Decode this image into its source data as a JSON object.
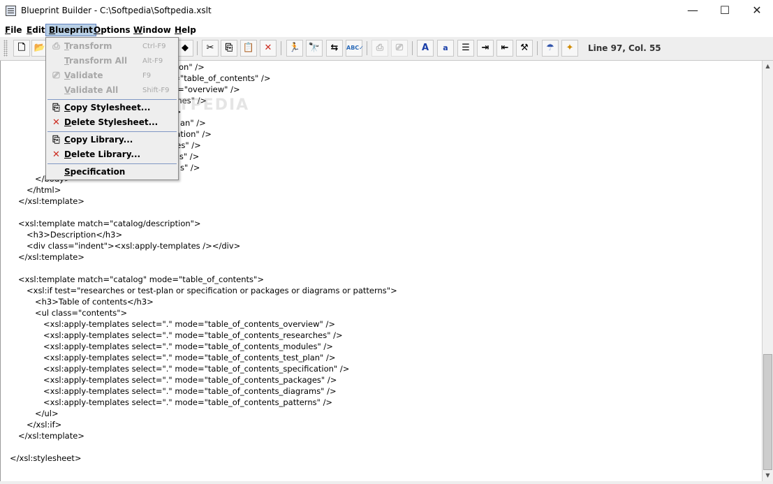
{
  "window": {
    "title": "Blueprint Builder - C:\\Softpedia\\Softpedia.xslt",
    "minimize_glyph": "—",
    "maximize_glyph": "☐",
    "close_glyph": "✕"
  },
  "menubar": {
    "items": [
      {
        "label": "File",
        "mnemonic": "F",
        "rest": "ile"
      },
      {
        "label": "Edit",
        "mnemonic": "E",
        "rest": "dit"
      },
      {
        "label": "Blueprint",
        "mnemonic": "B",
        "rest": "lueprint"
      },
      {
        "label": "Options",
        "mnemonic": "O",
        "rest": "ptions"
      },
      {
        "label": "Window",
        "mnemonic": "W",
        "rest": "indow"
      },
      {
        "label": "Help",
        "mnemonic": "H",
        "rest": "elp"
      }
    ]
  },
  "toolbar": {
    "status": "Line 97, Col. 55",
    "font_large_label": "A",
    "font_small_label": "a",
    "icons": [
      "new-file-icon",
      "open-folder-icon",
      "save-icon",
      "scissors-icon",
      "copy-icon",
      "paste-icon",
      "delete-icon",
      "run-icon",
      "find-icon",
      "find-replace-icon",
      "spellcheck-icon",
      "transform-disabled-icon",
      "validate-disabled-icon",
      "font-large-icon",
      "font-small-icon",
      "align-justify-icon",
      "indent-icon",
      "outdent-icon",
      "tools-icon",
      "web-icon",
      "wizard-icon"
    ]
  },
  "blueprint_menu": {
    "items": [
      {
        "label": "Transform",
        "mnemonic": "T",
        "rest": "ransform",
        "shortcut": "Ctrl-F9",
        "enabled": false,
        "icon": "transform-icon"
      },
      {
        "label": "Transform All",
        "mnemonic": "T",
        "rest": "ransform All",
        "shortcut": "Alt-F9",
        "enabled": false,
        "icon": ""
      },
      {
        "label": "Validate",
        "mnemonic": "V",
        "rest": "alidate",
        "shortcut": "F9",
        "enabled": false,
        "icon": "validate-icon"
      },
      {
        "label": "Validate All",
        "mnemonic": "V",
        "rest": "alidate All",
        "shortcut": "Shift-F9",
        "enabled": false,
        "icon": ""
      },
      {
        "label": "Copy Stylesheet...",
        "mnemonic": "C",
        "rest": "opy Stylesheet...",
        "shortcut": "",
        "enabled": true,
        "icon": "copy-icon"
      },
      {
        "label": "Delete Stylesheet...",
        "mnemonic": "D",
        "rest": "elete Stylesheet...",
        "shortcut": "",
        "enabled": true,
        "icon": "delete-icon"
      },
      {
        "label": "Copy Library...",
        "mnemonic": "C",
        "rest": "opy Library...",
        "shortcut": "",
        "enabled": true,
        "icon": "copy-icon"
      },
      {
        "label": "Delete Library...",
        "mnemonic": "D",
        "rest": "elete Library...",
        "shortcut": "",
        "enabled": true,
        "icon": "delete-icon"
      },
      {
        "label": "Specification",
        "mnemonic": "S",
        "rest": "pecification",
        "shortcut": "",
        "enabled": true,
        "icon": ""
      }
    ]
  },
  "watermark": "SOFTPEDIA",
  "editor": {
    "lines": [
      {
        "text": "ption\" />",
        "indent": 240
      },
      {
        "text": "de=\"table_of_contents\" />",
        "indent": 233
      },
      {
        "text": "e=\"overview\" />",
        "indent": 246
      },
      {
        "text": "ches\" />",
        "indent": 246
      },
      {
        "text": "es\" />",
        "indent": 223,
        "highlight": "es\""
      },
      {
        "text": "an\" />",
        "indent": 257
      },
      {
        "text": "cation\" />",
        "indent": 244
      },
      {
        "text": "ges\" />",
        "indent": 244
      },
      {
        "text": "rns\" />",
        "indent": 244
      },
      {
        "text": "s\" />",
        "indent": 257
      },
      {
        "text": "</body>",
        "indent": 49
      },
      {
        "text": "</html>",
        "indent": 37
      },
      {
        "text": "</xsl:template>",
        "indent": 25
      },
      {
        "text": "",
        "indent": 0
      },
      {
        "text": "<xsl:template match=\"catalog/description\">",
        "indent": 25
      },
      {
        "text": "<h3>Description</h3>",
        "indent": 37
      },
      {
        "text": "<div class=\"indent\"><xsl:apply-templates /></div>",
        "indent": 37
      },
      {
        "text": "</xsl:template>",
        "indent": 25
      },
      {
        "text": "",
        "indent": 0
      },
      {
        "text": "<xsl:template match=\"catalog\" mode=\"table_of_contents\">",
        "indent": 25
      },
      {
        "text": "<xsl:if test=\"researches or test-plan or specification or packages or diagrams or patterns\">",
        "indent": 37
      },
      {
        "text": "<h3>Table of contents</h3>",
        "indent": 49
      },
      {
        "text": "<ul class=\"contents\">",
        "indent": 49
      },
      {
        "text": "<xsl:apply-templates select=\".\" mode=\"table_of_contents_overview\" />",
        "indent": 61
      },
      {
        "text": "<xsl:apply-templates select=\".\" mode=\"table_of_contents_researches\" />",
        "indent": 61
      },
      {
        "text": "<xsl:apply-templates select=\".\" mode=\"table_of_contents_modules\" />",
        "indent": 61
      },
      {
        "text": "<xsl:apply-templates select=\".\" mode=\"table_of_contents_test_plan\" />",
        "indent": 61
      },
      {
        "text": "<xsl:apply-templates select=\".\" mode=\"table_of_contents_specification\" />",
        "indent": 61
      },
      {
        "text": "<xsl:apply-templates select=\".\" mode=\"table_of_contents_packages\" />",
        "indent": 61
      },
      {
        "text": "<xsl:apply-templates select=\".\" mode=\"table_of_contents_diagrams\" />",
        "indent": 61
      },
      {
        "text": "<xsl:apply-templates select=\".\" mode=\"table_of_contents_patterns\" />",
        "indent": 61
      },
      {
        "text": "</ul>",
        "indent": 49
      },
      {
        "text": "</xsl:if>",
        "indent": 37
      },
      {
        "text": "</xsl:template>",
        "indent": 25
      },
      {
        "text": "",
        "indent": 0
      },
      {
        "text": "</xsl:stylesheet>",
        "indent": 13
      }
    ]
  },
  "colors": {
    "menu_active_bg": "#b8cfe5",
    "menu_active_border": "#6382bf",
    "toolbar_bg": "#eeeeee",
    "delete_red": "#cc2a1e"
  }
}
